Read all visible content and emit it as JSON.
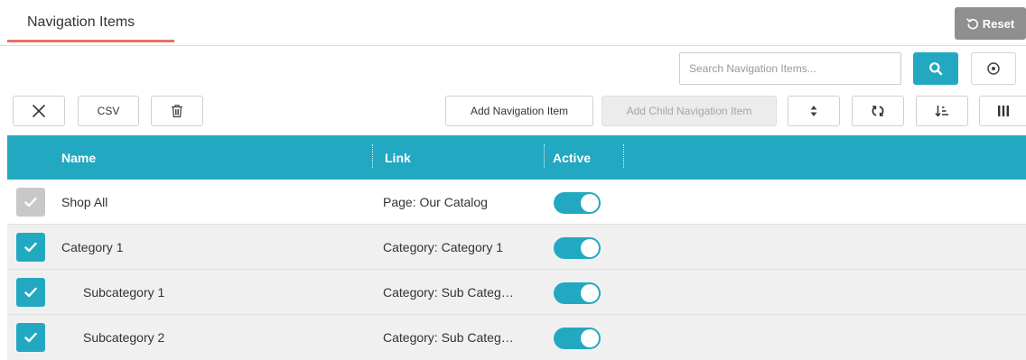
{
  "tab": {
    "title": "Navigation Items"
  },
  "reset": {
    "label": "Reset"
  },
  "search": {
    "placeholder": "Search Navigation Items..."
  },
  "toolbar": {
    "csv_label": "CSV",
    "add_item_label": "Add Navigation Item",
    "add_child_label": "Add Child Navigation Item"
  },
  "columns": {
    "name": "Name",
    "link": "Link",
    "active": "Active"
  },
  "colors": {
    "accent": "#22a9c1",
    "tab_underline": "#ec7065",
    "reset_bg": "#8f8f8f"
  },
  "rows": [
    {
      "name": "Shop All",
      "link": "Page: Our Catalog",
      "active": true,
      "selected": false
    },
    {
      "name": "Category 1",
      "link": "Category: Category 1",
      "active": true,
      "selected": true
    },
    {
      "name": "Subcategory 1",
      "link": "Category: Sub Categ…",
      "active": true,
      "selected": true
    },
    {
      "name": "Subcategory 2",
      "link": "Category: Sub Categ…",
      "active": true,
      "selected": true
    }
  ]
}
